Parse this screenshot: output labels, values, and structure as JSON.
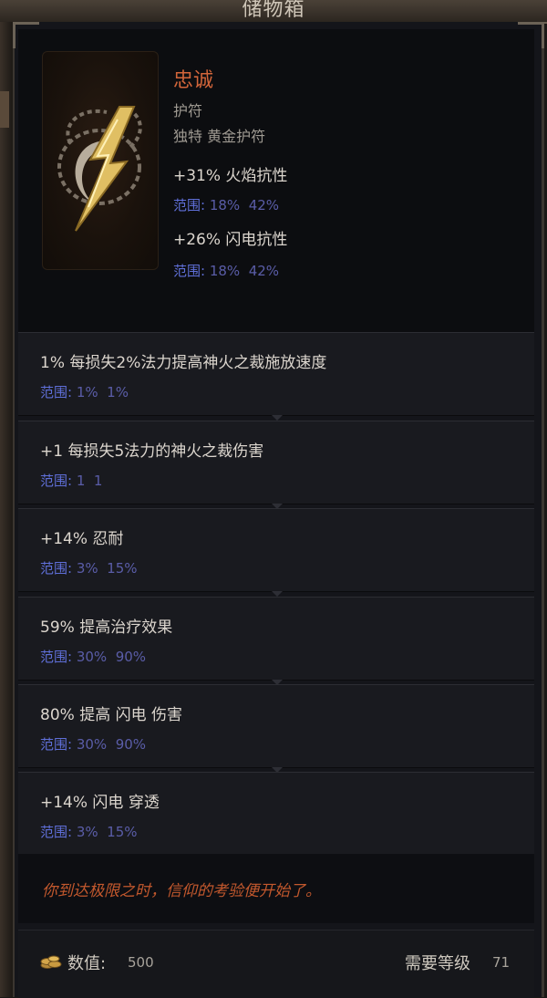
{
  "window": {
    "title": "储物箱"
  },
  "item": {
    "name": "忠诚",
    "type": "护符",
    "base": "独特 黄金护符",
    "implicits": [
      {
        "text": "+31% 火焰抗性",
        "range_label": "范围:",
        "range_values": "18%  42%"
      },
      {
        "text": "+26% 闪电抗性",
        "range_label": "范围:",
        "range_values": "18%  42%"
      }
    ]
  },
  "modifiers": [
    {
      "text": "1% 每损失2%法力提高神火之裁施放速度",
      "range_label": "范围:",
      "range_values": "1%  1%"
    },
    {
      "text": "+1 每损失5法力的神火之裁伤害",
      "range_label": "范围:",
      "range_values": "1  1"
    },
    {
      "text": "+14% 忍耐",
      "range_label": "范围:",
      "range_values": "3%  15%"
    },
    {
      "text": "59% 提高治疗效果",
      "range_label": "范围:",
      "range_values": "30%  90%"
    },
    {
      "text": "80% 提高 闪电 伤害",
      "range_label": "范围:",
      "range_values": "30%  90%"
    },
    {
      "text": "+14% 闪电 穿透",
      "range_label": "范围:",
      "range_values": "3%  15%"
    }
  ],
  "flavor": "你到达极限之时，信仰的考验便开始了。",
  "footer": {
    "value_label": "数值:",
    "value": "500",
    "level_label": "需要等级",
    "level": "71"
  },
  "icons": {
    "coin": "coin-stack-icon",
    "item": "lightning-amulet-icon"
  },
  "colors": {
    "unique_name": "#d2653a",
    "range": "#5f6fd8",
    "flavor": "#c2582d"
  }
}
